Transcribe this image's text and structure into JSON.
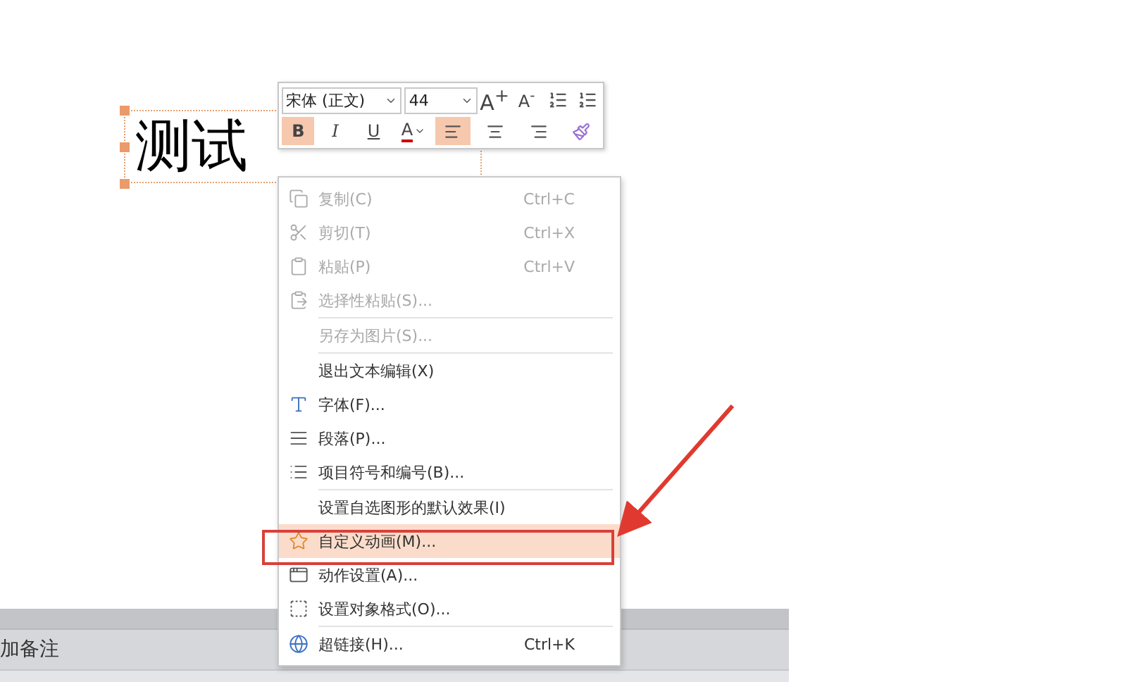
{
  "slide": {
    "text": "测试"
  },
  "mini_toolbar": {
    "font": "宋体 (正文)",
    "size": "44",
    "top_buttons": [
      {
        "kind": "grow",
        "label": "A$^{+}$"
      },
      {
        "kind": "shrink",
        "label": "A$^{-}$"
      },
      {
        "kind": "spacing_up"
      },
      {
        "kind": "spacing_down"
      }
    ],
    "buttons": [
      {
        "kind": "bold",
        "label": "B",
        "selected": true
      },
      {
        "kind": "italic",
        "label": "I",
        "selected": false
      },
      {
        "kind": "underline",
        "label": "U",
        "selected": false
      },
      {
        "kind": "font_color",
        "label": "A",
        "selected": false
      },
      {
        "kind": "align_left",
        "selected": true
      },
      {
        "kind": "align_center",
        "selected": false
      },
      {
        "kind": "align_right",
        "selected": false
      },
      {
        "kind": "painter",
        "selected": false
      }
    ]
  },
  "context_menu": {
    "items": [
      {
        "kind": "copy",
        "label": "复制(C)",
        "shortcut": "Ctrl+C",
        "disabled": true,
        "selected": false,
        "separator_before": false
      },
      {
        "kind": "cut",
        "label": "剪切(T)",
        "shortcut": "Ctrl+X",
        "disabled": true,
        "selected": false,
        "separator_before": false
      },
      {
        "kind": "paste",
        "label": "粘贴(P)",
        "shortcut": "Ctrl+V",
        "disabled": true,
        "selected": false,
        "separator_before": false
      },
      {
        "kind": "paste_special",
        "label": "选择性粘贴(S)...",
        "disabled": true,
        "selected": false,
        "separator_before": false
      },
      {
        "kind": "plain",
        "label": "另存为图片(S)...",
        "disabled": true,
        "selected": false,
        "separator_before": true
      },
      {
        "kind": "plain",
        "label": "退出文本编辑(X)",
        "disabled": false,
        "selected": false,
        "separator_before": true
      },
      {
        "kind": "font",
        "label": "字体(F)...",
        "disabled": false,
        "selected": false,
        "separator_before": false
      },
      {
        "kind": "paragraph",
        "label": "段落(P)...",
        "disabled": false,
        "selected": false,
        "separator_before": false
      },
      {
        "kind": "bullets",
        "label": "项目符号和编号(B)...",
        "disabled": false,
        "selected": false,
        "separator_before": false
      },
      {
        "kind": "plain",
        "label": "设置自选图形的默认效果(I)",
        "disabled": false,
        "selected": false,
        "separator_before": true
      },
      {
        "kind": "animation",
        "label": "自定义动画(M)...",
        "disabled": false,
        "selected": true,
        "separator_before": false
      },
      {
        "kind": "action",
        "label": "动作设置(A)...",
        "disabled": false,
        "selected": false,
        "separator_before": false
      },
      {
        "kind": "format",
        "label": "设置对象格式(O)...",
        "disabled": false,
        "selected": false,
        "separator_before": false
      },
      {
        "kind": "link",
        "label": "超链接(H)...",
        "shortcut": "Ctrl+K",
        "disabled": false,
        "selected": false,
        "separator_before": true
      }
    ]
  },
  "notes_panel": {
    "label": "加备注"
  }
}
